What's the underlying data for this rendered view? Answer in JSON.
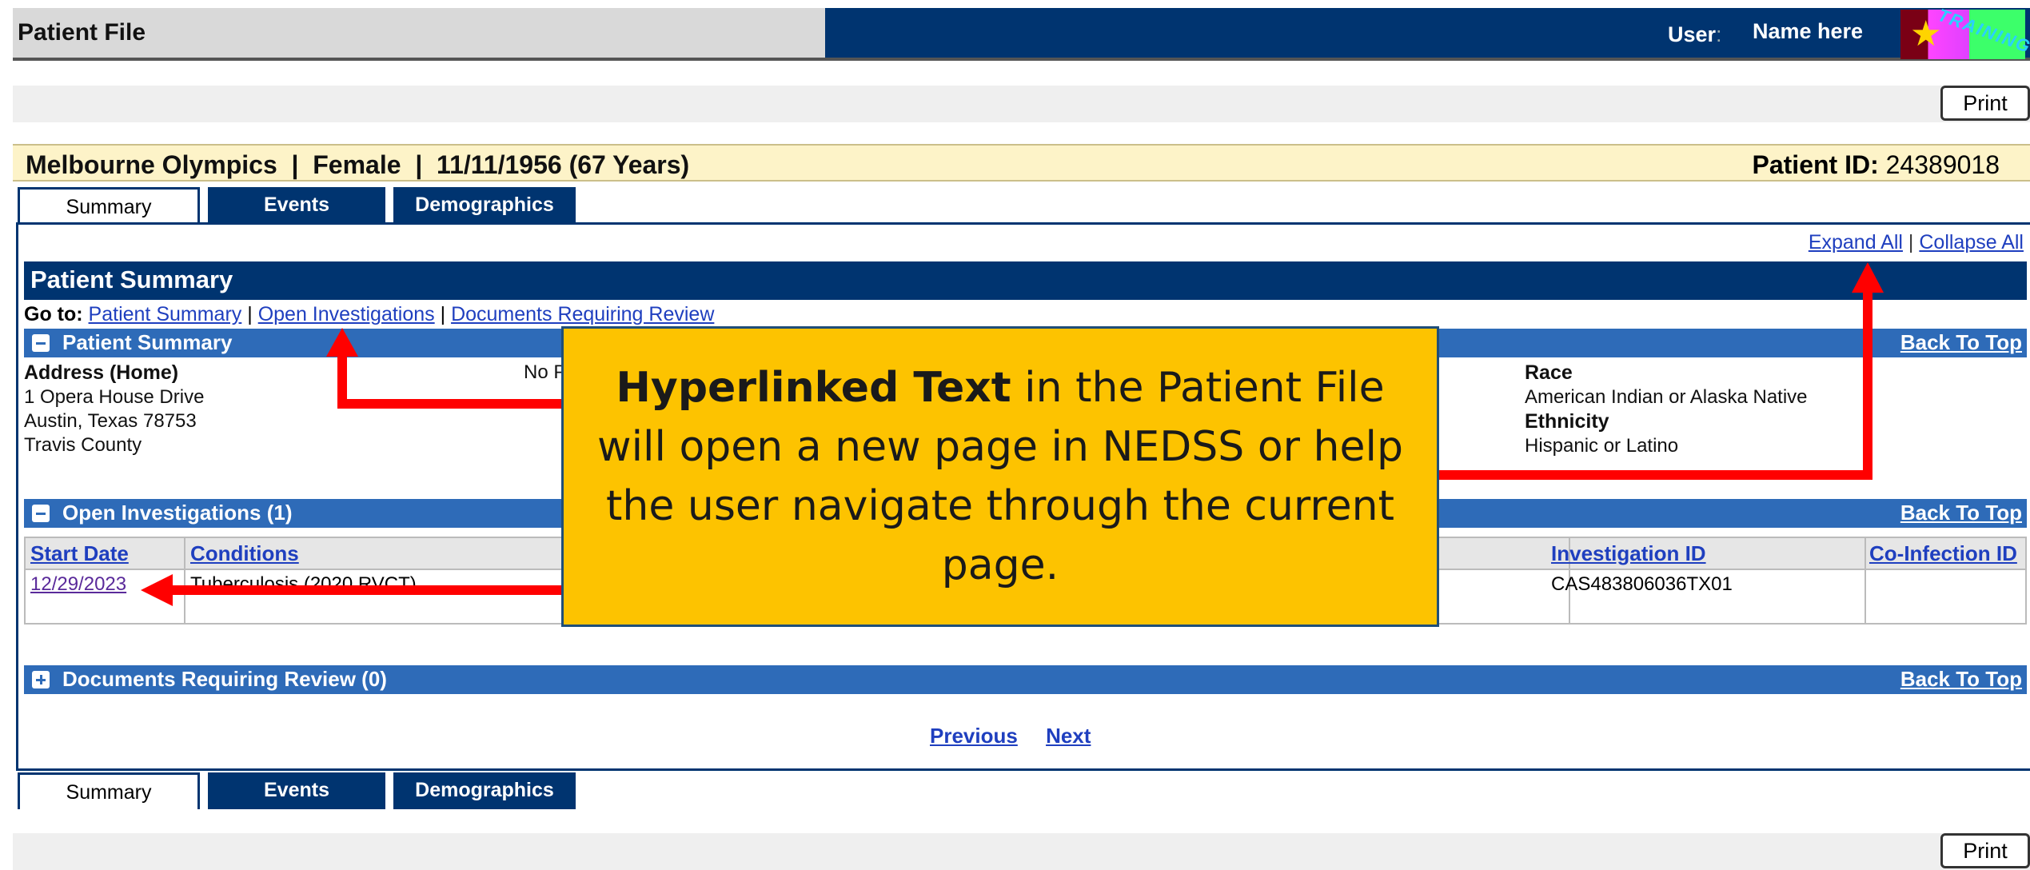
{
  "header": {
    "title": "Patient File",
    "user_label": "User",
    "user_sep": ":",
    "user_name": "Name here",
    "badge_text": "TRAINING",
    "badge_icon": "star-icon"
  },
  "print_label": "Print",
  "patient": {
    "info": "Melbourne Olympics  |  Female  |  11/11/1956 (67 Years)",
    "id_label": "Patient ID:",
    "id_value": "24389018"
  },
  "tabs": [
    {
      "label": "Summary",
      "active": true
    },
    {
      "label": "Events",
      "active": false
    },
    {
      "label": "Demographics",
      "active": false
    }
  ],
  "links": {
    "expand_all": "Expand All",
    "sep": "|",
    "collapse_all": "Collapse All"
  },
  "summary": {
    "title": "Patient Summary",
    "goto_label": "Go to:",
    "goto_links": [
      "Patient Summary",
      "Open Investigations",
      "Documents Requiring Review"
    ]
  },
  "sections": {
    "patient_summary": {
      "title": "Patient Summary",
      "back": "Back To Top"
    },
    "open_investigations": {
      "title": "Open Investigations (1)",
      "back": "Back To Top"
    },
    "documents": {
      "title": "Documents Requiring Review (0)",
      "back": "Back To Top"
    }
  },
  "address": {
    "label": "Address (Home)",
    "line1": "1 Opera House Drive",
    "line2": "Austin, Texas 78753",
    "line3": "Travis County",
    "phone_partial": "No P"
  },
  "race": {
    "label": "Race",
    "value": "American Indian or Alaska Native",
    "eth_label": "Ethnicity",
    "eth_value": "Hispanic or Latino"
  },
  "investigations": {
    "headers": {
      "start_date": "Start Date",
      "conditions": "Conditions",
      "investigation_id": "Investigation ID",
      "coinfection_id": "Co-Infection ID"
    },
    "rows": [
      {
        "start_date": "12/29/2023",
        "condition": "Tuberculosis (2020 RVCT)",
        "investigation_id": "CAS483806036TX01",
        "coinfection_id": ""
      }
    ]
  },
  "pager": {
    "previous": "Previous",
    "next": "Next"
  },
  "callout": {
    "bold": "Hyperlinked Text",
    "rest": " in the Patient File will open a new page in NEDSS or help the user navigate through the current page."
  },
  "colors": {
    "navy": "#003470",
    "section_blue": "#2e6bb8",
    "callout": "#fdc300",
    "arrow": "#ff0000",
    "patient_bar": "#fdf3c8"
  }
}
